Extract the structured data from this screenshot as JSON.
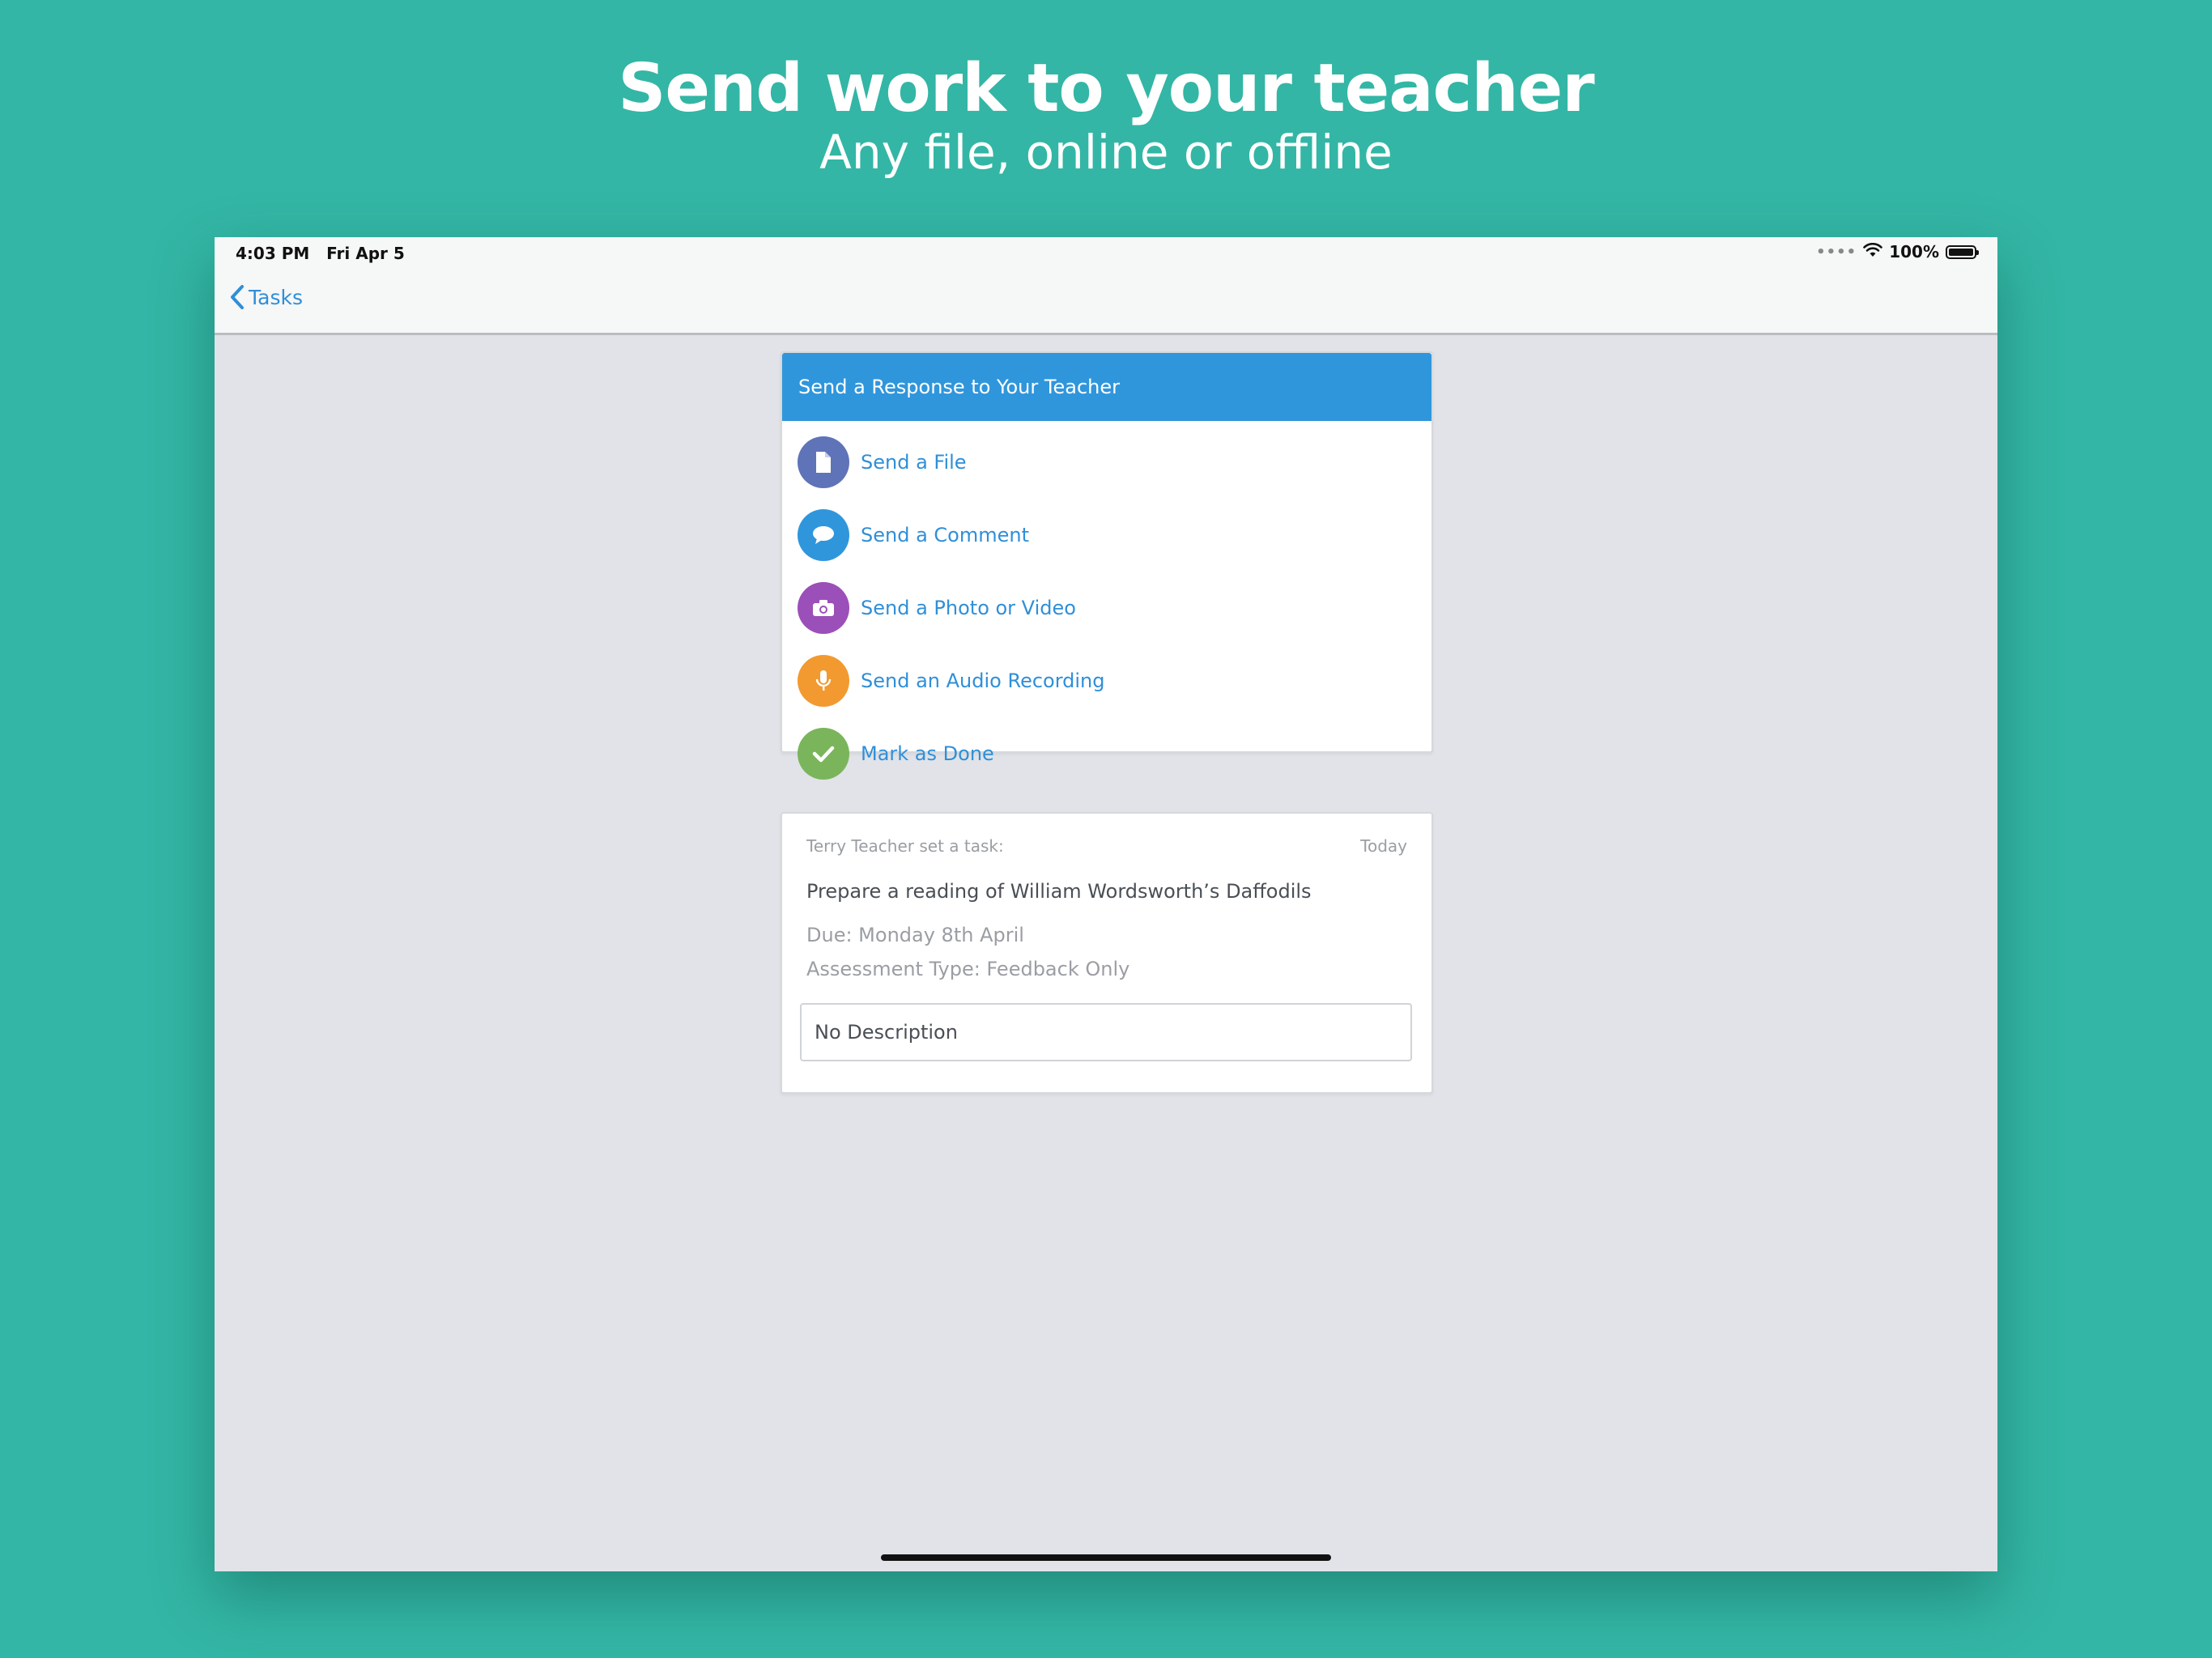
{
  "promo": {
    "headline": "Send work to your teacher",
    "subline": "Any file, online or offline"
  },
  "status_bar": {
    "time": "4:03 PM",
    "date": "Fri Apr 5",
    "battery": "100%",
    "icons": [
      "signal-dots-icon",
      "wifi-icon",
      "battery-icon"
    ]
  },
  "nav": {
    "back_label": "Tasks",
    "back_icon": "chevron-left-icon"
  },
  "response_panel": {
    "title": "Send a Response to Your Teacher",
    "actions": [
      {
        "label": "Send a File",
        "icon": "file-icon",
        "color": "#5f73b8"
      },
      {
        "label": "Send a Comment",
        "icon": "comment-icon",
        "color": "#2f96dc"
      },
      {
        "label": "Send a Photo or Video",
        "icon": "camera-icon",
        "color": "#9b4fb8"
      },
      {
        "label": "Send an Audio Recording",
        "icon": "microphone-icon",
        "color": "#f29a30"
      },
      {
        "label": "Mark as Done",
        "icon": "checkmark-icon",
        "color": "#7ab55c"
      }
    ]
  },
  "task": {
    "setter": "Terry Teacher set a task:",
    "when": "Today",
    "title": "Prepare a reading of William Wordsworth’s Daffodils",
    "due": "Due: Monday 8th April",
    "assessment": "Assessment Type: Feedback Only",
    "description": "No Description"
  },
  "colors": {
    "background": "#33b6a5",
    "accent": "#2f96dc",
    "link": "#2f8fd8"
  }
}
